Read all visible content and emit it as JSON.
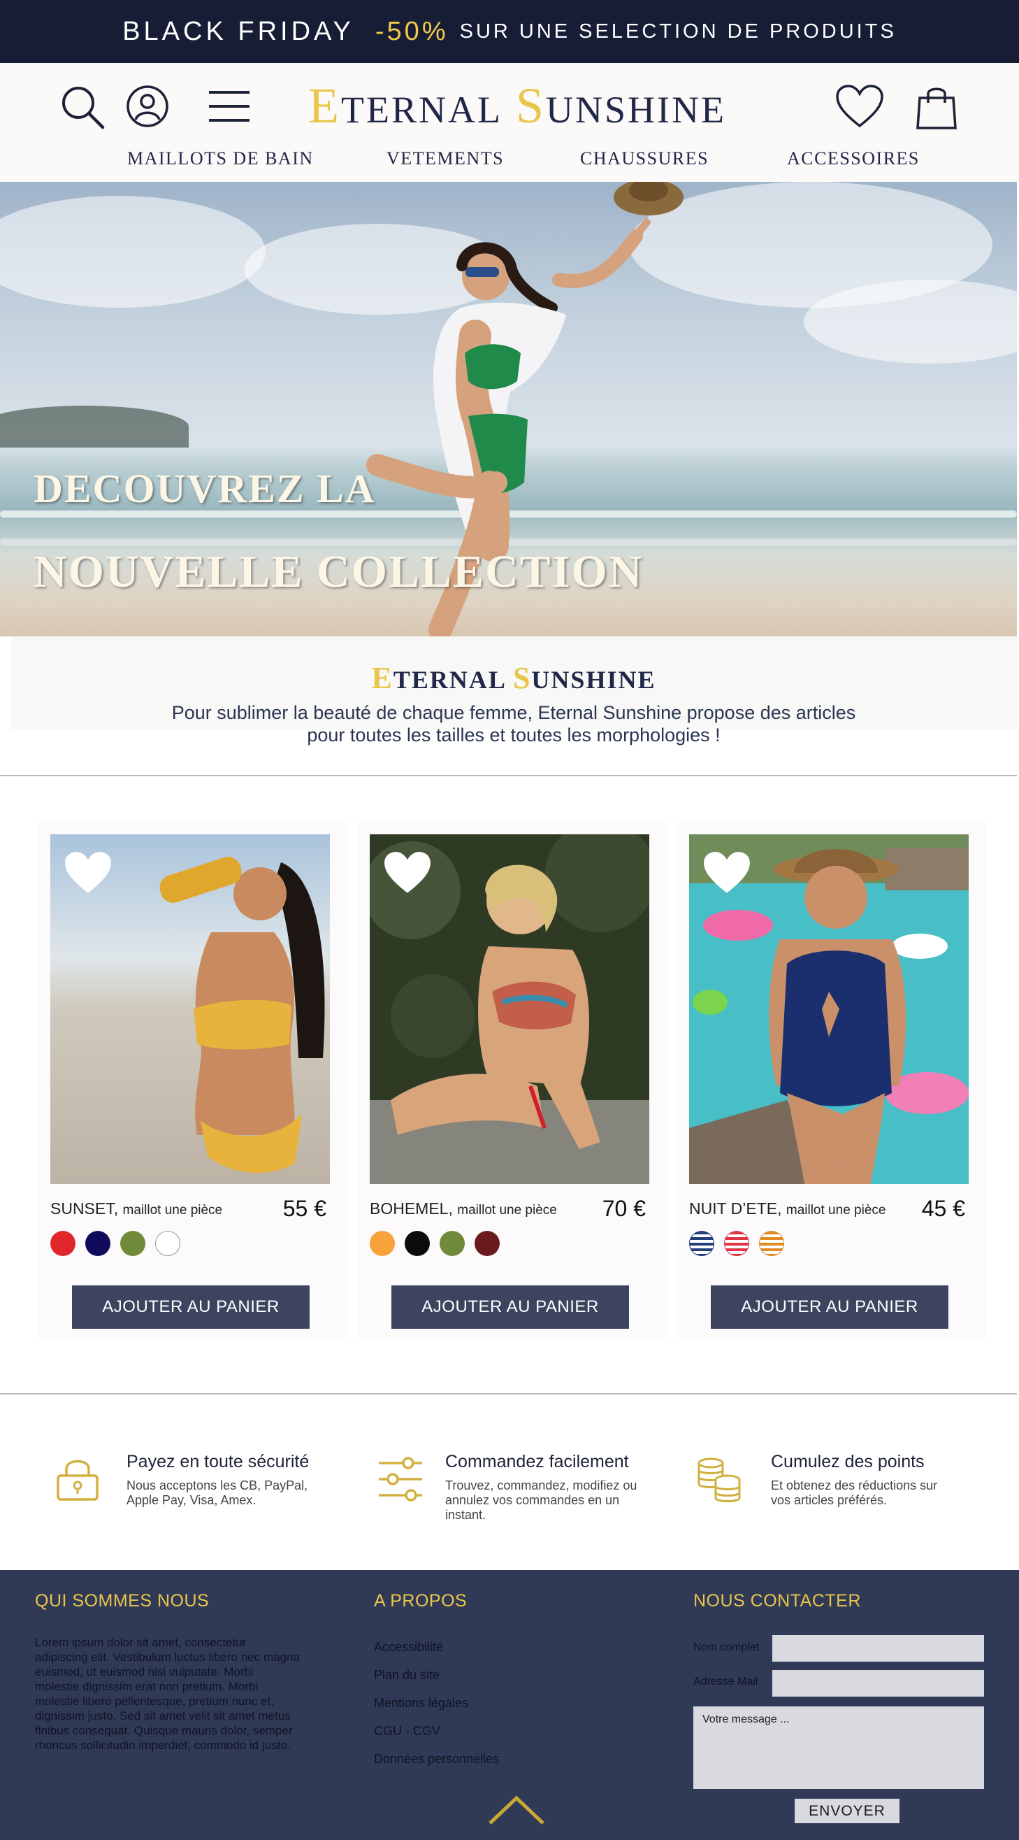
{
  "promo": {
    "black_friday": "BLACK FRIDAY",
    "discount": "-50%",
    "text": "SUR UNE SELECTION DE PRODUITS"
  },
  "header": {
    "logo": {
      "e_cap": "E",
      "e_rest": "TERNAL",
      "s_cap": "S",
      "s_rest": "UNSHINE"
    },
    "icons": {
      "search": "search-icon",
      "account": "user-icon",
      "menu": "menu-icon",
      "wishlist": "heart-icon",
      "cart": "shopping-bag-icon"
    },
    "nav": [
      "MAILLOTS DE BAIN",
      "VETEMENTS",
      "CHAUSSURES",
      "ACCESSOIRES"
    ]
  },
  "hero": {
    "line1": "DECOUVREZ LA",
    "line2": "NOUVELLE COLLECTION"
  },
  "intro": {
    "brand": {
      "e_cap": "E",
      "e_rest": "TERNAL",
      "s_cap": "S",
      "s_rest": "UNSHINE"
    },
    "line1": "Pour sublimer la beauté de chaque femme, Eternal Sunshine propose des articles",
    "line2": "pour toutes les tailles et toutes les morphologies !"
  },
  "products": [
    {
      "name": "SUNSET,",
      "type": "maillot une pièce",
      "price": "55 €",
      "button": "AJOUTER AU PANIER",
      "swatches": [
        "#e0262a",
        "#100a5c",
        "#6f8b3a",
        "#ffffff"
      ]
    },
    {
      "name": "BOHEMEL,",
      "type": "maillot une pièce",
      "price": "70 €",
      "button": "AJOUTER AU PANIER",
      "swatches": [
        "#f7a23b",
        "#0c0c0c",
        "#6f8b3a",
        "#6a1a1c"
      ]
    },
    {
      "name": "NUIT D’ETE,",
      "type": "maillot une pièce",
      "price": "45 €",
      "button": "AJOUTER AU PANIER",
      "swatches": [
        "stripes-navy",
        "stripes-red",
        "stripes-orange"
      ]
    }
  ],
  "features": [
    {
      "title": "Payez en toute sécurité",
      "desc": "Nous acceptons les CB, PayPal, Apple Pay, Visa, Amex.",
      "icon": "lock-icon"
    },
    {
      "title": "Commandez facilement",
      "desc": "Trouvez, commandez, modifiez ou annulez vos commandes en un instant.",
      "icon": "sliders-icon"
    },
    {
      "title": "Cumulez des points",
      "desc": "Et obtenez des réductions sur vos articles préférés.",
      "icon": "coins-icon"
    }
  ],
  "footer": {
    "about_title": "QUI SOMMES NOUS",
    "about_text": "Lorem ipsum dolor sit amet, consectetur adipiscing elit. Vestibulum luctus libero nec magna euismod, ut euismod nisi vulputate. Morbi molestie dignissim erat non pretium. Morbi molestie libero pellentesque, pretium nunc et, dignissim justo. Sed sit amet velit sit amet metus finibus consequat. Quisque mauris dolor, semper rhoncus sollicitudin imperdiet, commodo id justo.",
    "links_title": "A PROPOS",
    "links": [
      "Accessibilité",
      "Plan du site",
      "Mentions légales",
      "CGU - CGV",
      "Données personnelles"
    ],
    "contact_title": "NOUS CONTACTER",
    "name_label": "Nom complet",
    "email_label": "Adresse Mail",
    "message_placeholder": "Votre message ...",
    "send_button": "ENVOYER"
  },
  "colors": {
    "navy": "#161d35",
    "gold": "#e9c64a",
    "footer": "#303956",
    "button": "#3c4460"
  }
}
